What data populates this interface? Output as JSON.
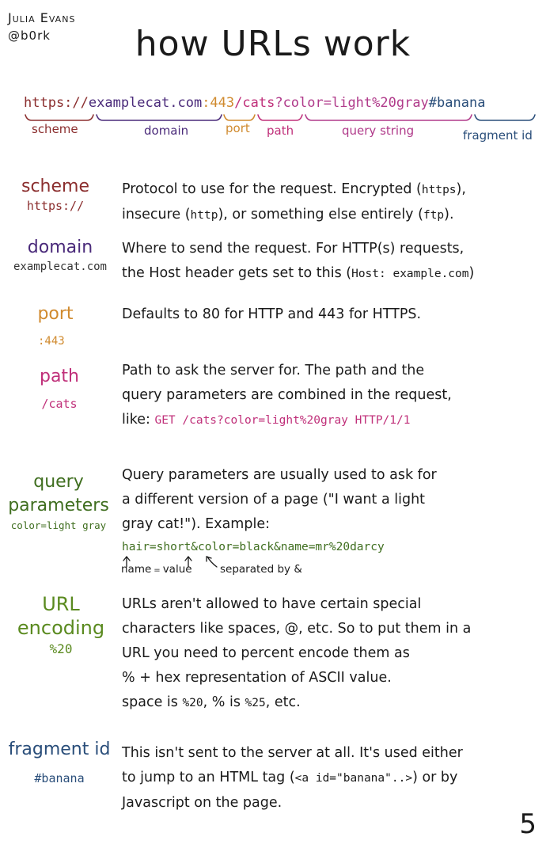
{
  "author": {
    "name": "Julia Evans",
    "handle": "@b0rk"
  },
  "title": "how URLs work",
  "colors": {
    "scheme": "#8b2e2e",
    "domain": "#4a2a7a",
    "port": "#d08a2e",
    "path": "#c0307a",
    "query": "#b03a8a",
    "fragment": "#2a4e7a",
    "query_green": "#3f6e1f",
    "encoding_green": "#5a8a1f"
  },
  "url": {
    "scheme": "https://",
    "domain": "examplecat.com",
    "port": ":443",
    "path": "/cats",
    "query": "?color=light%20gray",
    "fragment": "#banana"
  },
  "url_labels": {
    "scheme": "scheme",
    "domain": "domain",
    "port": "port",
    "path": "path",
    "query": "query string",
    "fragment": "fragment id"
  },
  "sections": [
    {
      "term": "scheme",
      "value": "https://",
      "desc": [
        "Protocol to use for the request. Encrypted (",
        "https",
        "),",
        "insecure (",
        "http",
        "), or something else entirely (",
        "ftp",
        ")."
      ]
    },
    {
      "term": "domain",
      "value": "examplecat.com",
      "desc": [
        "Where to send the request. For HTTP(s) requests,",
        "the Host header gets set to this (",
        "Host: example.com",
        ")"
      ]
    },
    {
      "term": "port",
      "value": ":443",
      "desc": [
        "Defaults to 80 for HTTP and 443 for HTTPS."
      ]
    },
    {
      "term": "path",
      "value": "/cats",
      "desc": [
        "Path to ask the server for. The path and the",
        "query parameters are combined in the request,",
        "like: ",
        "GET /cats?color=light%20gray HTTP/1/1"
      ]
    },
    {
      "term": "query parameters",
      "term_a": "query",
      "term_b": "parameters",
      "value": "color=light gray",
      "desc": [
        "Query parameters are usually used to ask for",
        "a different version of a page (\"I want a light",
        "gray cat!\"). Example:"
      ],
      "example": "hair=short&color=black&name=mr%20darcy",
      "annotations": {
        "name": "name",
        "eq": "=",
        "value": "value",
        "sep": "separated by &"
      }
    },
    {
      "term": "URL encoding",
      "term_a": "URL",
      "term_b": "encoding",
      "value": "%20",
      "desc": [
        "URLs aren't allowed to have certain special",
        "characters like spaces, @, etc. So to put them in a",
        "URL you need to percent encode them as",
        "% + hex representation of ASCII value.",
        "space is ",
        "%20",
        ", % is ",
        "%25",
        ", etc."
      ]
    },
    {
      "term": "fragment id",
      "value": "#banana",
      "desc": [
        "This isn't sent to the server at all. It's used either",
        "to jump to an HTML tag (",
        "<a id=\"banana\"..>",
        ") or by",
        "Javascript on the page."
      ]
    }
  ],
  "page_number": "5"
}
